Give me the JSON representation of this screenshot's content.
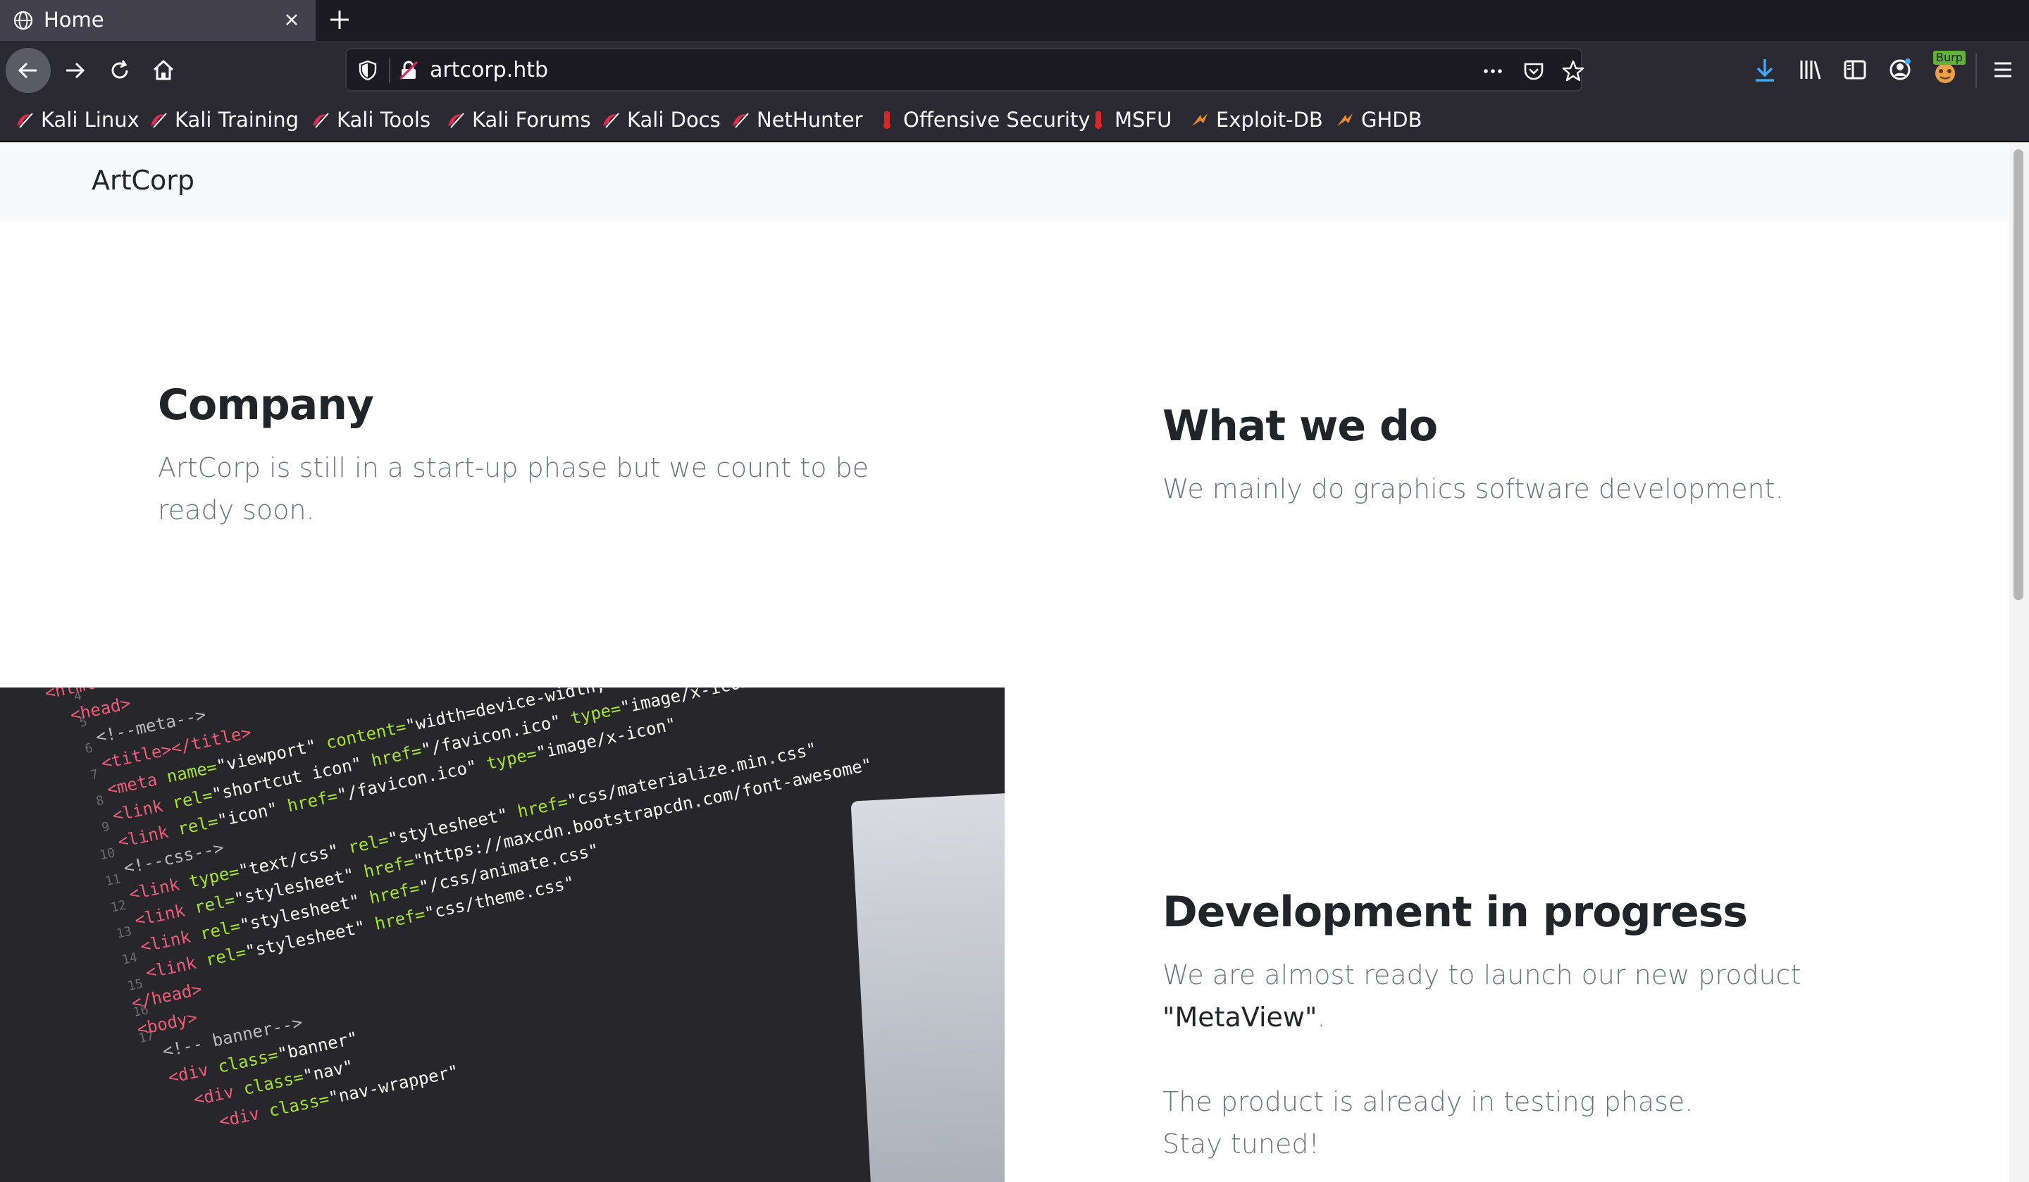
{
  "browser": {
    "tab": {
      "title": "Home",
      "close_icon": "close-icon",
      "icon": "globe-icon"
    },
    "new_tab_icon": "plus-icon",
    "url": "artcorp.htb",
    "bookmarks": [
      {
        "label": "Kali Linux",
        "icon": "kali-icon"
      },
      {
        "label": "Kali Training",
        "icon": "kali-icon"
      },
      {
        "label": "Kali Tools",
        "icon": "kali-icon"
      },
      {
        "label": "Kali Forums",
        "icon": "kali-icon"
      },
      {
        "label": "Kali Docs",
        "icon": "kali-icon"
      },
      {
        "label": "NetHunter",
        "icon": "kali-icon"
      },
      {
        "label": "Offensive Security",
        "icon": "offsec-icon"
      },
      {
        "label": "MSFU",
        "icon": "offsec-icon"
      },
      {
        "label": "Exploit-DB",
        "icon": "exploitdb-icon"
      },
      {
        "label": "GHDB",
        "icon": "exploitdb-icon"
      }
    ],
    "burp_badge": "Burp"
  },
  "site": {
    "brand": "ArtCorp",
    "company": {
      "heading": "Company",
      "text_line1": "ArtCorp is still in a start-up phase but we count to be",
      "text_line2": "ready soon."
    },
    "what_we_do": {
      "heading": "What we do",
      "text": "We mainly do graphics software development."
    },
    "development": {
      "heading": "Development in progress",
      "text_line1": "We are almost ready to launch our new product",
      "product": "\"MetaView\"",
      "product_suffix": ".",
      "text_line3": "The product is already in testing phase.",
      "text_line4": "Stay tuned!"
    }
  },
  "colors": {
    "tabbar": "#1c1b22",
    "navbar": "#2b2a33",
    "tab_active": "#42414d",
    "download_accent": "#0df",
    "page_heading": "#212529",
    "page_text": "#6c757d"
  }
}
